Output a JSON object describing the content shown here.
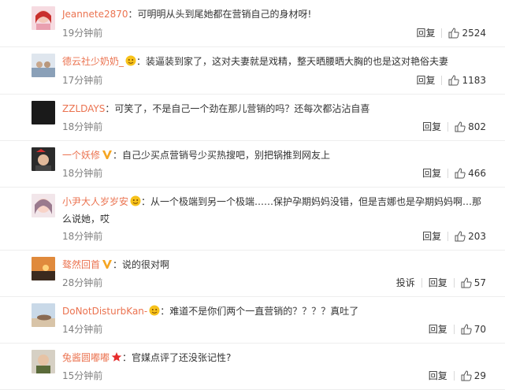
{
  "colors": {
    "username": "#eb7350",
    "muted": "#808080",
    "text": "#333333",
    "divider": "#eeeeee"
  },
  "comments": [
    {
      "username": "Jeannete2870",
      "badge": null,
      "text": "可明明从头到尾她都在营销自己的身材呀!",
      "time": "19分钟前",
      "report": null,
      "reply": "回复",
      "likes": "2524",
      "avatar_icon": "user-avatar-photo"
    },
    {
      "username": "德云社少奶奶_",
      "badge": "emoji-badge-icon",
      "text": "装逼装到家了，这对夫妻就是戏精，整天晒腰晒大胸的也是这对艳俗夫妻",
      "time": "17分钟前",
      "report": null,
      "reply": "回复",
      "likes": "1183",
      "avatar_icon": "user-avatar-photo"
    },
    {
      "username": "ZZLDAYS",
      "badge": null,
      "text": "可笑了，不是自己一个劲在那儿营销的吗？还每次都沾沾自喜",
      "time": "18分钟前",
      "report": null,
      "reply": "回复",
      "likes": "802",
      "avatar_icon": "user-avatar-photo"
    },
    {
      "username": "一个妖修",
      "badge": "verified-v-icon",
      "text": "自己少买点营销号少买热搜吧，别把锅推到网友上",
      "time": "18分钟前",
      "report": null,
      "reply": "回复",
      "likes": "466",
      "avatar_icon": "user-avatar-photo"
    },
    {
      "username": "小尹大人岁岁安",
      "badge": "emoji-badge-icon",
      "text": "从一个极端到另一个极端……保护孕期妈妈没错，但是吉娜也是孕期妈妈啊…那么说她，哎",
      "time": "18分钟前",
      "report": null,
      "reply": "回复",
      "likes": "203",
      "avatar_icon": "user-avatar-photo"
    },
    {
      "username": "骜然回首",
      "badge": "verified-v-icon",
      "text": "说的很对啊",
      "time": "28分钟前",
      "report": "投诉",
      "reply": "回复",
      "likes": "57",
      "avatar_icon": "user-avatar-photo"
    },
    {
      "username": "DoNotDisturbKan-",
      "badge": "emoji-badge-icon",
      "text": "难道不是你们两个一直营销的？？？？真吐了",
      "time": "14分钟前",
      "report": null,
      "reply": "回复",
      "likes": "70",
      "avatar_icon": "user-avatar-photo"
    },
    {
      "username": "兔酱圆嘟嘟",
      "badge": "star-badge-icon",
      "text": "官媒点评了还没张记性?",
      "time": "15分钟前",
      "report": null,
      "reply": "回复",
      "likes": "29",
      "avatar_icon": "user-avatar-photo"
    }
  ]
}
